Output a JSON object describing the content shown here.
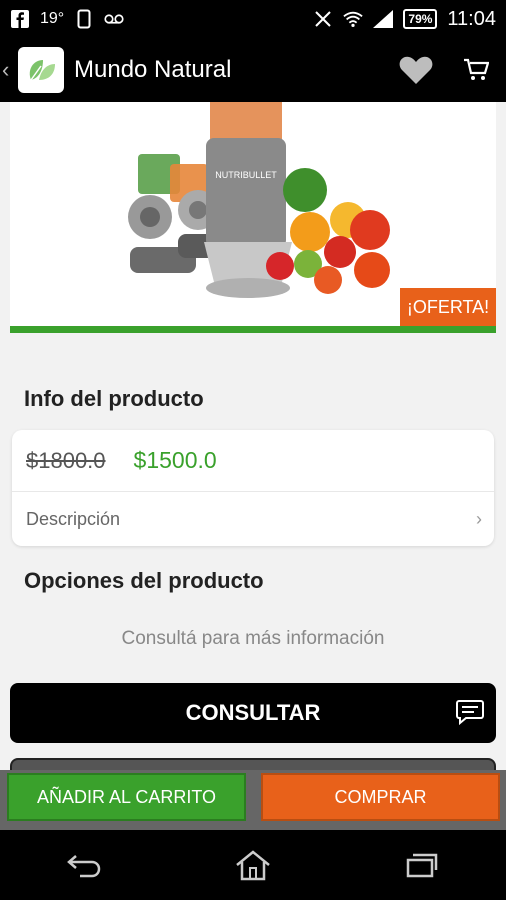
{
  "status_bar": {
    "signal_temp": "19°",
    "battery": "79%",
    "time": "11:04",
    "icons": [
      "facebook-icon",
      "phone-icon",
      "voicemail-icon",
      "vibrate-off-icon",
      "wifi-icon",
      "signal-icon"
    ]
  },
  "app_bar": {
    "title": "Mundo Natural",
    "icons": [
      "back-chevron-icon",
      "leaf-logo",
      "heart-icon",
      "cart-icon"
    ]
  },
  "hero": {
    "badge": "¡OFERTA!",
    "product_label": "NUTRIBULLET"
  },
  "info": {
    "section_title": "Info del producto",
    "old_price": "$1800.0",
    "new_price": "$1500.0",
    "description_label": "Descripción"
  },
  "options": {
    "section_title": "Opciones del producto",
    "consult_text": "Consultá para más información"
  },
  "buttons": {
    "consultar": "CONSULTAR",
    "add_to_cart": "AÑADIR AL CARRITO",
    "buy": "COMPRAR"
  },
  "colors": {
    "accent_green": "#3aa12c",
    "accent_orange": "#e8611a",
    "bar_black": "#000000"
  }
}
